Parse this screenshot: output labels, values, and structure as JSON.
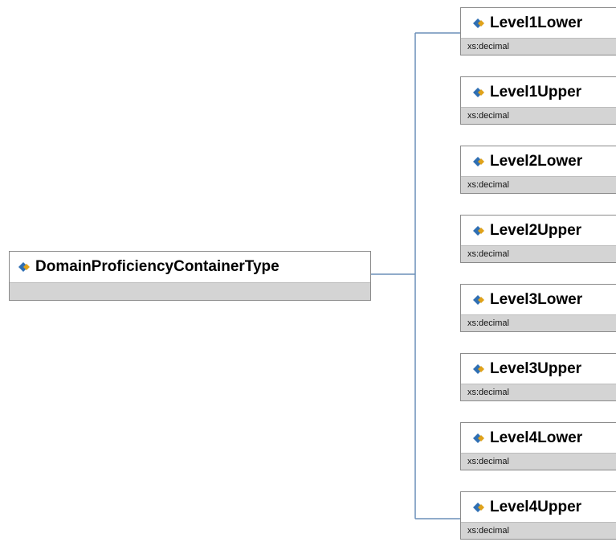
{
  "root": {
    "name": "DomainProficiencyContainerType",
    "icon": "complex-type-icon"
  },
  "children": [
    {
      "name": "Level1Lower",
      "type": "xs:decimal",
      "icon": "element-icon"
    },
    {
      "name": "Level1Upper",
      "type": "xs:decimal",
      "icon": "element-icon"
    },
    {
      "name": "Level2Lower",
      "type": "xs:decimal",
      "icon": "element-icon"
    },
    {
      "name": "Level2Upper",
      "type": "xs:decimal",
      "icon": "element-icon"
    },
    {
      "name": "Level3Lower",
      "type": "xs:decimal",
      "icon": "element-icon"
    },
    {
      "name": "Level3Upper",
      "type": "xs:decimal",
      "icon": "element-icon"
    },
    {
      "name": "Level4Lower",
      "type": "xs:decimal",
      "icon": "element-icon"
    },
    {
      "name": "Level4Upper",
      "type": "xs:decimal",
      "icon": "element-icon"
    }
  ],
  "colors": {
    "connector": "#6b8fb8",
    "icon_blue": "#2f6fb3",
    "icon_gold": "#e0a21a",
    "footer": "#d4d4d4"
  }
}
